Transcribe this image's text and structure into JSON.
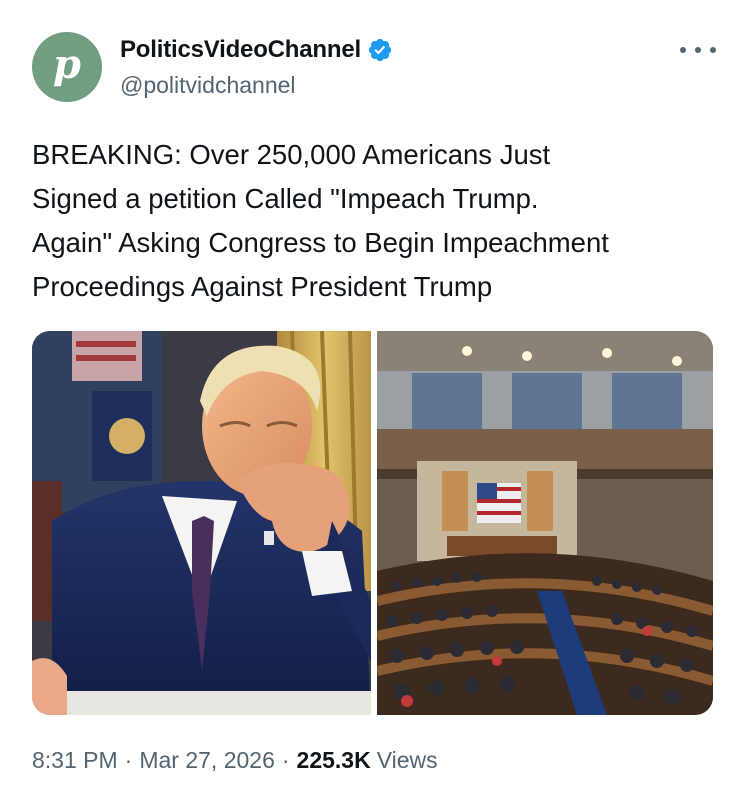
{
  "author": {
    "display_name": "PoliticsVideoChannel",
    "handle": "@politvidchannel",
    "avatar_letter": "p",
    "avatar_color": "#6f9e80",
    "verified": true,
    "verified_color": "#1d9bf0"
  },
  "tweet": {
    "text": "BREAKING: Over 250,000 Americans Just\nSigned a petition Called \"Impeach Trump.\nAgain\" Asking Congress to Begin Impeachment\nProceedings Against President Trump"
  },
  "media": {
    "images": [
      {
        "icon": "photo-man-in-suit"
      },
      {
        "icon": "photo-house-chamber"
      }
    ]
  },
  "meta": {
    "time": "8:31 PM",
    "date": "Mar 27, 2026",
    "separator": "·",
    "views_count": "225.3K",
    "views_label": "Views"
  },
  "icons": {
    "more": "more-horizontal-icon",
    "verified": "verified-badge-icon"
  }
}
